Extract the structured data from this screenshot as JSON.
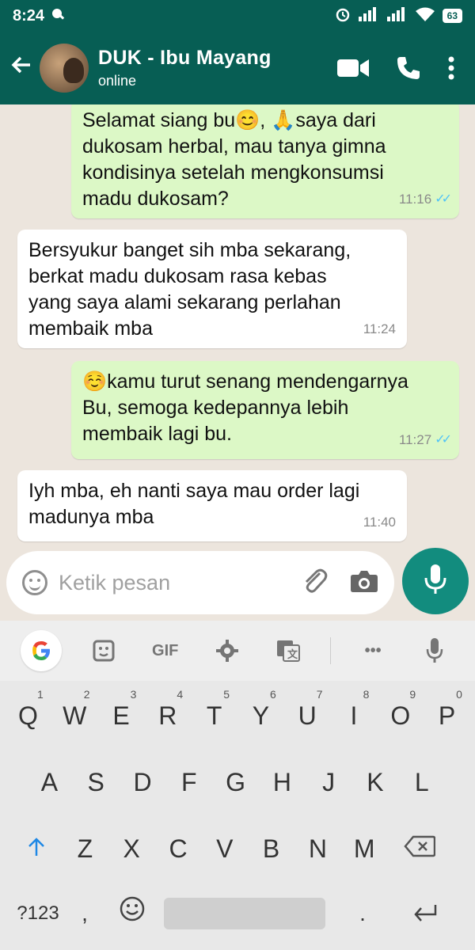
{
  "status_bar": {
    "time": "8:24",
    "battery": "63"
  },
  "header": {
    "contact_name": "DUK - Ibu Mayang",
    "contact_status": "online"
  },
  "messages": [
    {
      "direction": "out",
      "lines": [
        "Selamat siang bu😊, 🙏saya dari",
        "dukosam herbal, mau tanya gimna",
        "kondisinya setelah mengkonsumsi",
        "madu dukosam?"
      ],
      "time": "11:16",
      "read": true
    },
    {
      "direction": "in",
      "lines": [
        "Bersyukur banget sih mba sekarang,",
        "berkat madu dukosam rasa kebas",
        "yang saya alami sekarang perlahan",
        "membaik mba"
      ],
      "time": "11:24"
    },
    {
      "direction": "out",
      "lines": [
        "☺️kamu turut senang mendengarnya",
        "Bu, semoga kedepannya lebih",
        "membaik lagi bu."
      ],
      "time": "11:27",
      "read": true
    },
    {
      "direction": "in",
      "lines": [
        "Iyh mba, eh nanti saya mau order lagi",
        "madunya mba"
      ],
      "time": "11:40"
    }
  ],
  "composer": {
    "placeholder": "Ketik pesan"
  },
  "keyboard": {
    "toolbar": [
      "G",
      "sticker",
      "GIF",
      "settings",
      "translate",
      "more",
      "mic"
    ],
    "gif_label": "GIF",
    "more_label": "•••",
    "row1": [
      {
        "key": "Q",
        "hint": "1"
      },
      {
        "key": "W",
        "hint": "2"
      },
      {
        "key": "E",
        "hint": "3"
      },
      {
        "key": "R",
        "hint": "4"
      },
      {
        "key": "T",
        "hint": "5"
      },
      {
        "key": "Y",
        "hint": "6"
      },
      {
        "key": "U",
        "hint": "7"
      },
      {
        "key": "I",
        "hint": "8"
      },
      {
        "key": "O",
        "hint": "9"
      },
      {
        "key": "P",
        "hint": "0"
      }
    ],
    "row2": [
      "A",
      "S",
      "D",
      "F",
      "G",
      "H",
      "J",
      "K",
      "L"
    ],
    "row3": [
      "Z",
      "X",
      "C",
      "V",
      "B",
      "N",
      "M"
    ],
    "symbols_label": "?123",
    "comma_label": ",",
    "period_label": ".",
    "shift_icon": "shift-arrow",
    "backspace_icon": "backspace",
    "enter_icon": "enter-arrow"
  },
  "colors": {
    "header": "#075e54",
    "outgoing_bubble": "#dcf8c6",
    "incoming_bubble": "#ffffff",
    "fab": "#128c7e",
    "read_ticks": "#4fc3f7"
  }
}
